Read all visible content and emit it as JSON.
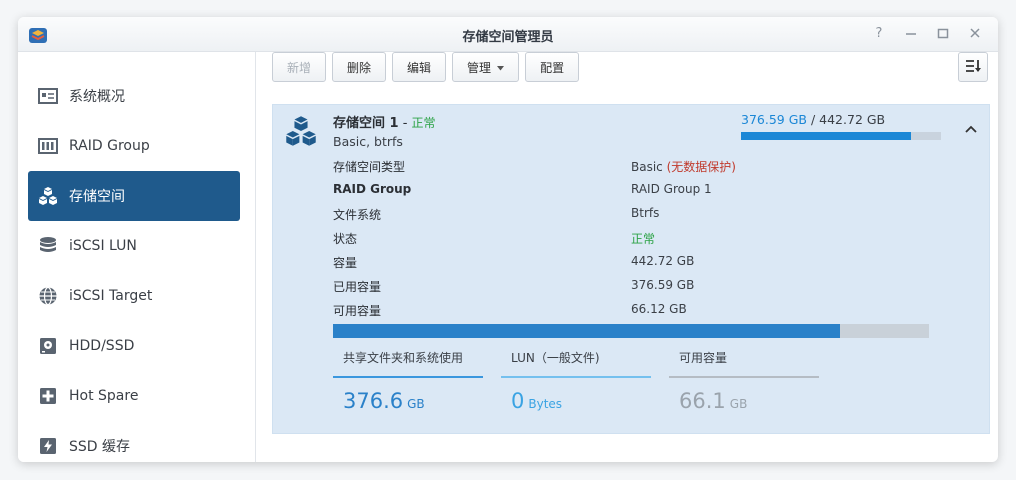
{
  "window": {
    "title": "存储空间管理员"
  },
  "sidebar": {
    "items": [
      {
        "label": "系统概况",
        "icon": "overview-icon"
      },
      {
        "label": "RAID Group",
        "icon": "raid-icon"
      },
      {
        "label": "存储空间",
        "icon": "storage-cubes-icon",
        "active": true
      },
      {
        "label": "iSCSI LUN",
        "icon": "database-icon"
      },
      {
        "label": "iSCSI Target",
        "icon": "globe-icon"
      },
      {
        "label": "HDD/SSD",
        "icon": "disk-icon"
      },
      {
        "label": "Hot Spare",
        "icon": "plus-box-icon"
      },
      {
        "label": "SSD 缓存",
        "icon": "ssd-cache-icon"
      }
    ]
  },
  "toolbar": {
    "create": "新增",
    "delete": "删除",
    "edit": "编辑",
    "manage": "管理",
    "configure": "配置"
  },
  "volume": {
    "name": "存储空间 1",
    "separator": " - ",
    "status": "正常",
    "subtitle": "Basic, btrfs",
    "used": "376.59 GB",
    "slash": " / ",
    "total": "442.72 GB",
    "usage_fraction": 0.85
  },
  "properties": [
    {
      "label": "存储空间类型",
      "value": "Basic",
      "extra": "(无数据保护)",
      "bold": false
    },
    {
      "label": "RAID Group",
      "value": "RAID Group 1",
      "bold": true
    },
    {
      "label": "文件系统",
      "value": "Btrfs",
      "bold": false
    },
    {
      "label": "状态",
      "value": "正常",
      "bold": false
    },
    {
      "label": "容量",
      "value": "442.72 GB",
      "bold": false
    },
    {
      "label": "已用容量",
      "value": "376.59 GB",
      "bold": false
    },
    {
      "label": "可用容量",
      "value": "66.12 GB",
      "bold": false
    }
  ],
  "stats": [
    {
      "label": "共享文件夹和系统使用",
      "value": "376.6",
      "unit": "GB",
      "color": "#2a81c9"
    },
    {
      "label": "LUN（一般文件)",
      "value": "0",
      "unit": "Bytes",
      "color": "#3aa3e3"
    },
    {
      "label": "可用容量",
      "value": "66.1",
      "unit": "GB",
      "color": "#9aa3ac"
    }
  ],
  "colors": {
    "accent": "#1f5a8c",
    "used_blue": "#1b87d6",
    "ok_green": "#2ba245",
    "warn_red": "#c0392b"
  }
}
